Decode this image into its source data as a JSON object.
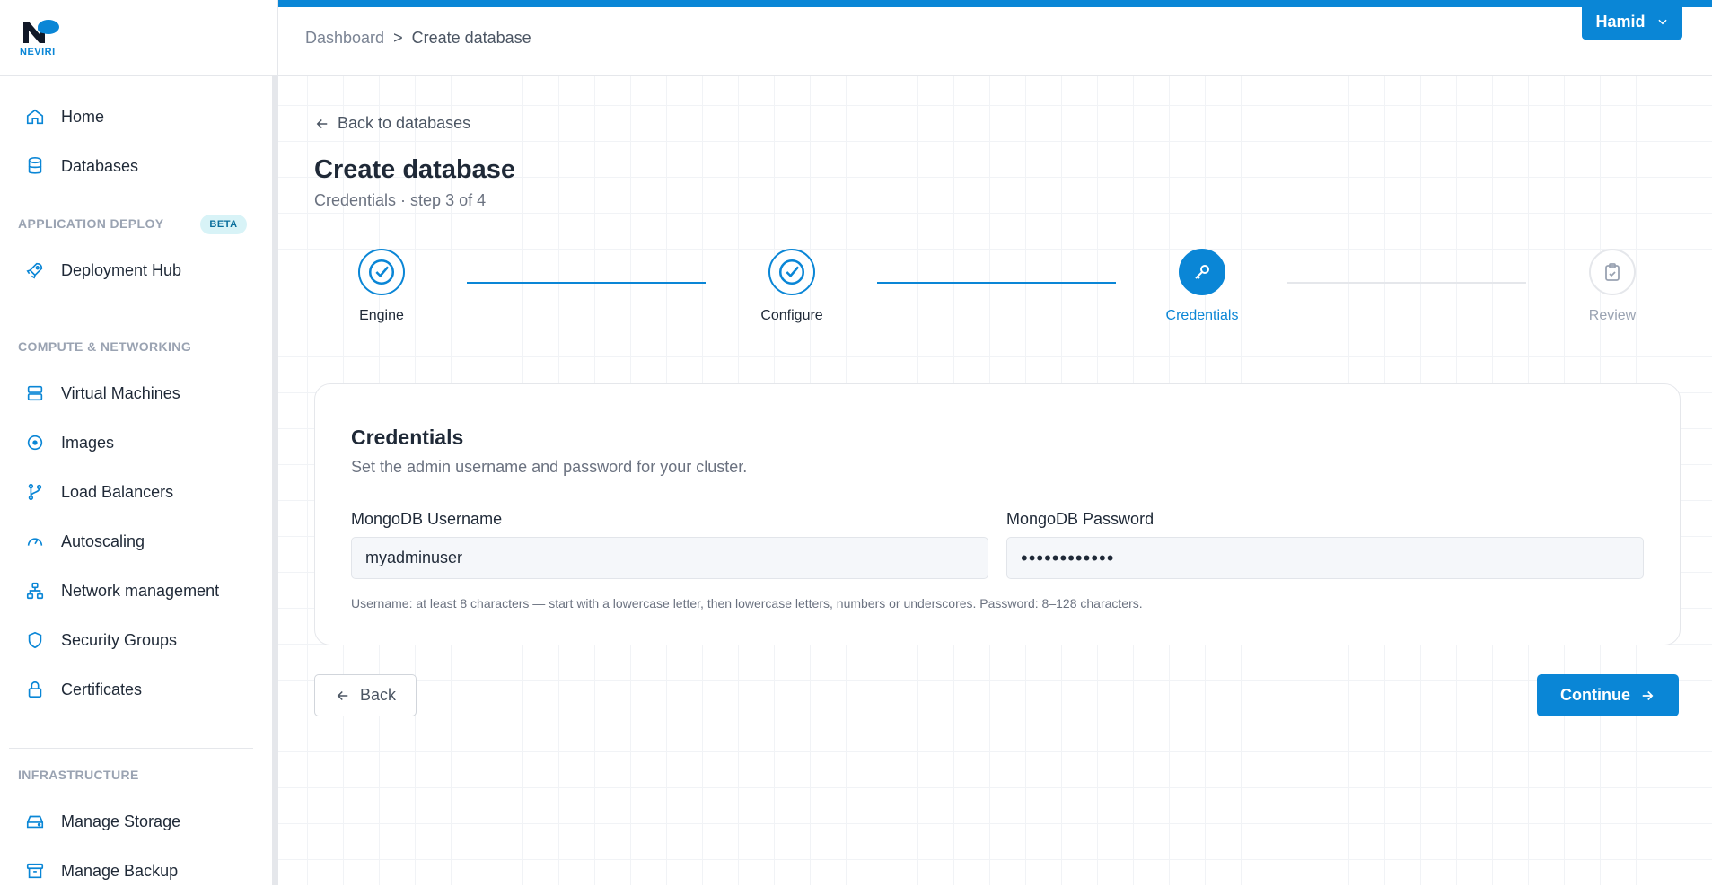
{
  "app": {
    "logo_text": "NEVIRI"
  },
  "sidebar": {
    "items": [
      {
        "label": "Home",
        "icon": "home-icon"
      },
      {
        "label": "Databases",
        "icon": "database-icon"
      },
      {
        "label": "Deployment Hub",
        "icon": "rocket-icon"
      },
      {
        "label": "Virtual Machines",
        "icon": "server-icon"
      },
      {
        "label": "Images",
        "icon": "disc-icon"
      },
      {
        "label": "Load Balancers",
        "icon": "branch-icon"
      },
      {
        "label": "Autoscaling",
        "icon": "gauge-icon"
      },
      {
        "label": "Network management",
        "icon": "network-icon"
      },
      {
        "label": "Security Groups",
        "icon": "shield-icon"
      },
      {
        "label": "Certificates",
        "icon": "lock-icon"
      },
      {
        "label": "Manage Storage",
        "icon": "storage-icon"
      },
      {
        "label": "Manage Backup",
        "icon": "archive-icon"
      }
    ],
    "sections": {
      "app_deploy": "APPLICATION DEPLOY",
      "app_deploy_badge": "BETA",
      "compute": "COMPUTE & NETWORKING",
      "infra": "INFRASTRUCTURE"
    }
  },
  "header": {
    "breadcrumb": [
      "Dashboard",
      ">",
      "Create database"
    ],
    "user": "Hamid"
  },
  "page": {
    "back_link": "Back to databases",
    "title": "Create database",
    "subtitle": "Credentials · step 3 of 4"
  },
  "stepper": {
    "steps": [
      {
        "label": "Engine",
        "state": "done"
      },
      {
        "label": "Configure",
        "state": "done"
      },
      {
        "label": "Credentials",
        "state": "active"
      },
      {
        "label": "Review",
        "state": "todo"
      }
    ]
  },
  "card": {
    "title": "Credentials",
    "description": "Set the admin username and password for your cluster.",
    "username_label": "MongoDB Username",
    "username_value": "myadminuser",
    "password_label": "MongoDB Password",
    "password_value": "••••••••••••",
    "hint": "Username: at least 8 characters — start with a lowercase letter, then lowercase letters, numbers or underscores. Password: 8–128 characters."
  },
  "actions": {
    "back": "Back",
    "continue": "Continue"
  },
  "colors": {
    "accent": "#0a86d6",
    "muted": "#9aa3b2"
  }
}
